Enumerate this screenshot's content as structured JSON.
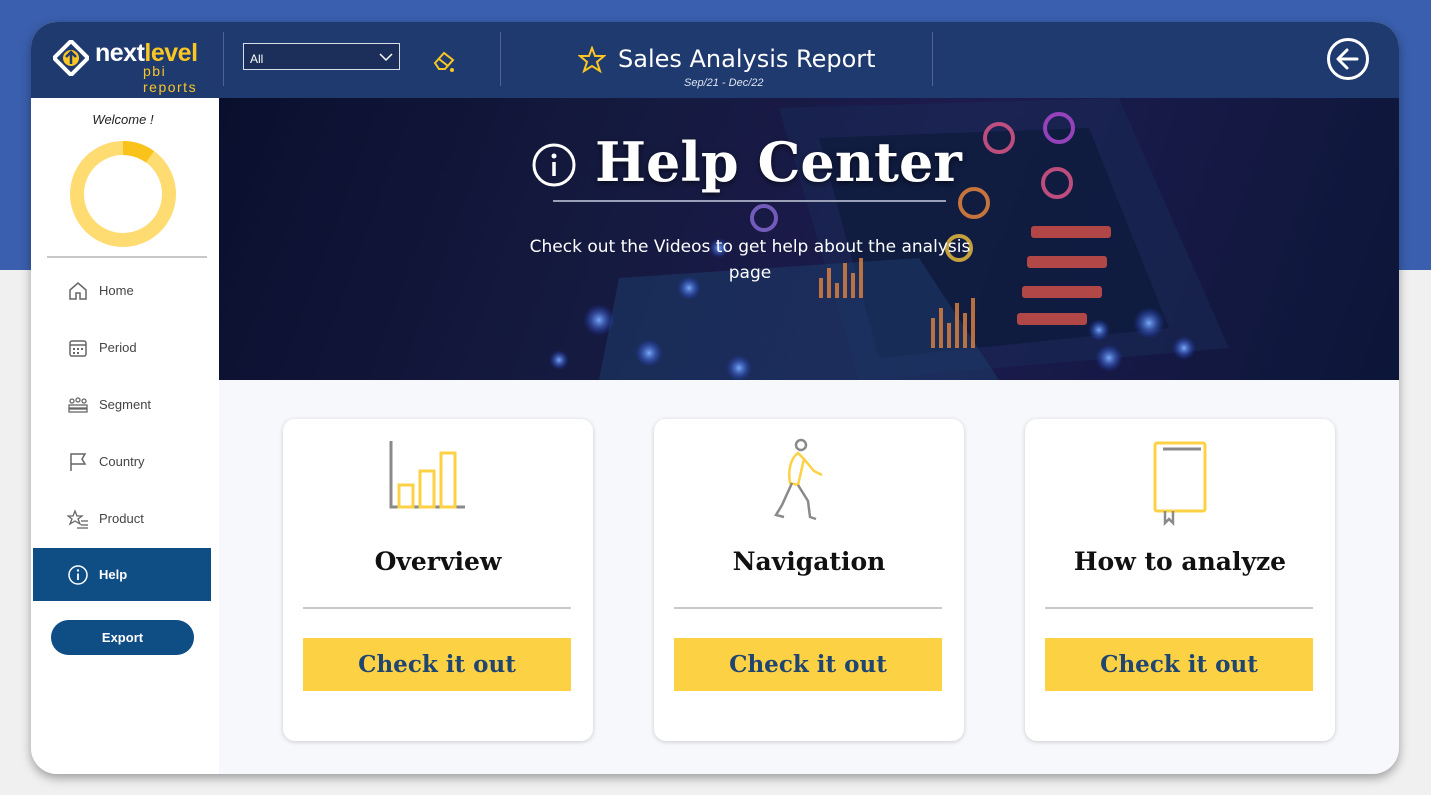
{
  "brand": {
    "name_primary": "next",
    "name_accent": "level",
    "tagline": "pbi reports"
  },
  "filter": {
    "selected": "All"
  },
  "header": {
    "title": "Sales Analysis Report",
    "subtitle": "Sep/21 - Dec/22"
  },
  "sidebar": {
    "welcome": "Welcome !",
    "progress_fraction": 0.1,
    "items": [
      {
        "label": "Home",
        "icon": "home-icon"
      },
      {
        "label": "Period",
        "icon": "calendar-icon"
      },
      {
        "label": "Segment",
        "icon": "people-icon"
      },
      {
        "label": "Country",
        "icon": "flag-icon"
      },
      {
        "label": "Product",
        "icon": "star-list-icon"
      },
      {
        "label": "Help",
        "icon": "info-icon",
        "active": true
      }
    ],
    "export_label": "Export"
  },
  "hero": {
    "title": "Help Center",
    "description": "Check out the Videos to get help about the analysis page"
  },
  "cards": [
    {
      "title": "Overview",
      "button": "Check it out",
      "icon": "bar-chart-icon"
    },
    {
      "title": "Navigation",
      "button": "Check it out",
      "icon": "walking-person-icon"
    },
    {
      "title": "How to analyze",
      "button": "Check it out",
      "icon": "book-icon"
    }
  ],
  "colors": {
    "header": "#1f3a6e",
    "accent": "#f9c623",
    "nav_active": "#0f4d85",
    "button": "#fdd144",
    "button_text": "#1f4670"
  }
}
